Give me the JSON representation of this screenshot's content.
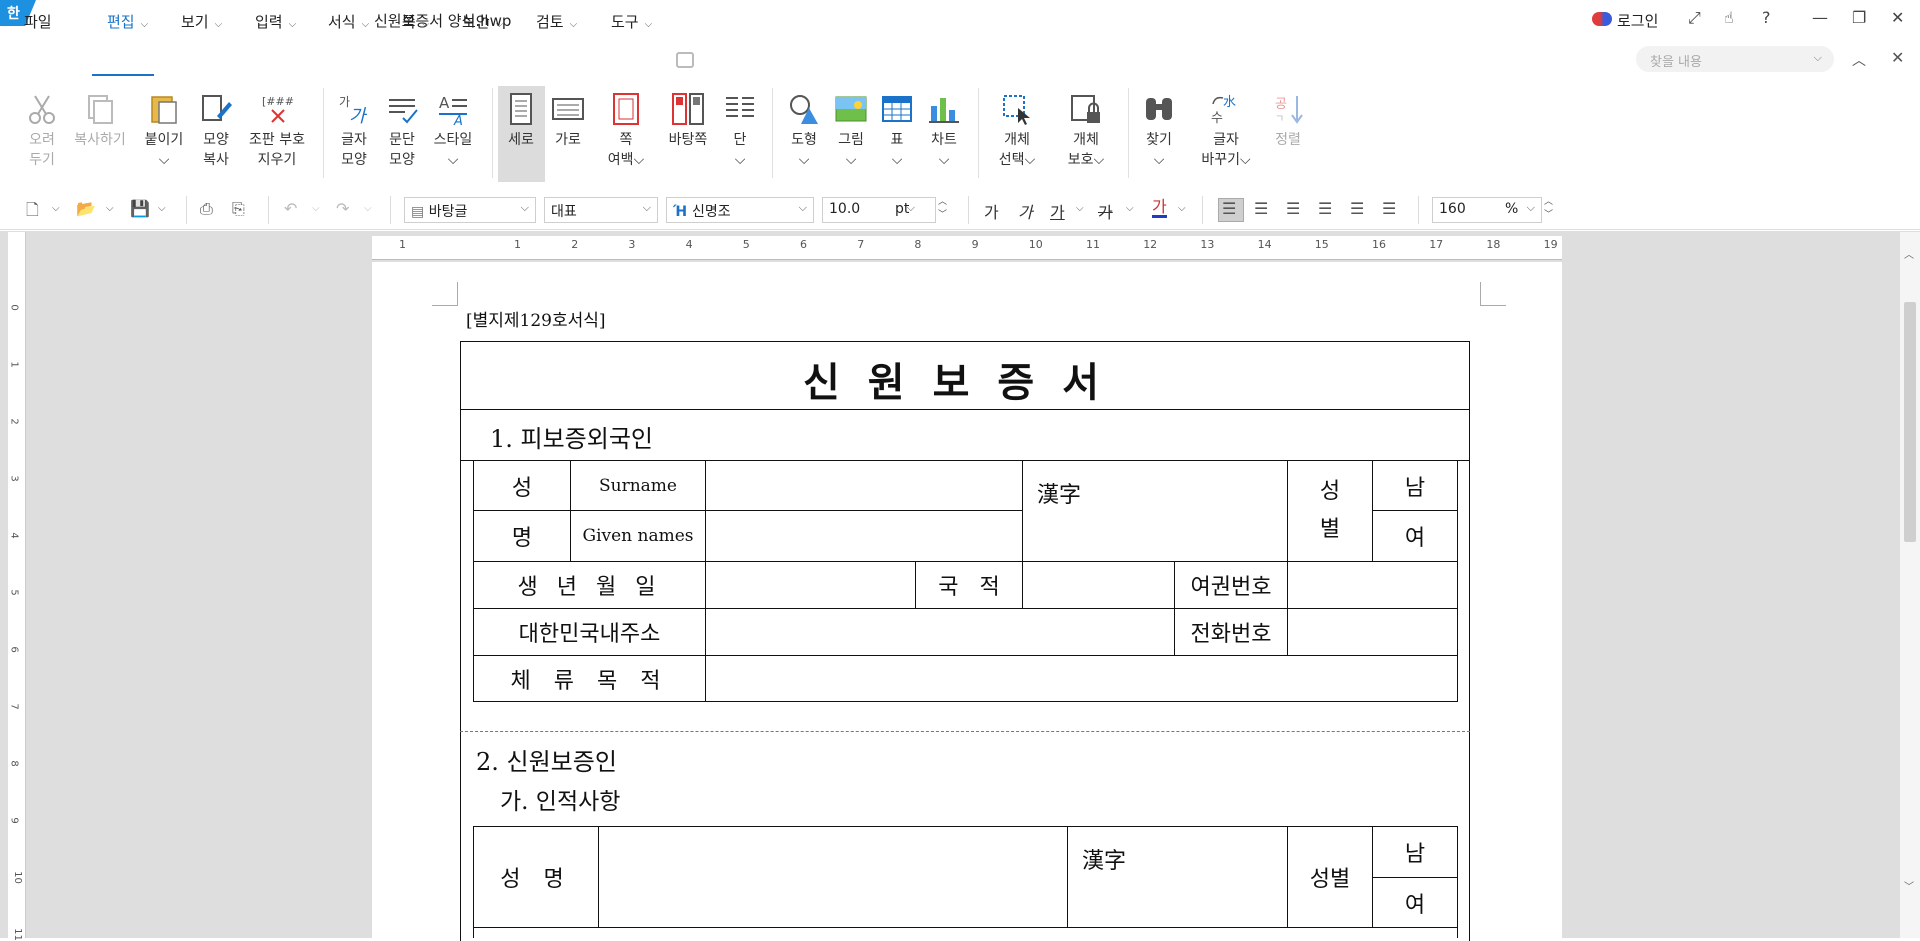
{
  "window": {
    "app_logo": "한",
    "title": "신원보증서 양식.hwp",
    "login_label": "로그인",
    "controls": [
      "⤢",
      "☝",
      "?",
      "—",
      "❐",
      "✕"
    ]
  },
  "menu": {
    "items": [
      "파일",
      "편집",
      "보기",
      "입력",
      "서식",
      "쪽",
      "보안",
      "검토",
      "도구"
    ],
    "search_placeholder": "찾을 내용"
  },
  "ribbon": {
    "cut": [
      "오려",
      "두기"
    ],
    "copy": "복사하기",
    "paste": "붙이기",
    "format_copy": [
      "모양",
      "복사"
    ],
    "erase_codes": [
      "조판 부호",
      "지우기"
    ],
    "char_shape": [
      "글자",
      "모양"
    ],
    "para_shape": [
      "문단",
      "모양"
    ],
    "style": "스타일",
    "portrait": "세로",
    "landscape": "가로",
    "page_margin": [
      "쪽",
      "여백"
    ],
    "master_page": "바탕쪽",
    "columns": "단",
    "shapes": "도형",
    "picture": "그림",
    "table": "표",
    "chart": "차트",
    "obj_select": [
      "개체",
      "선택"
    ],
    "obj_protect": [
      "개체",
      "보호"
    ],
    "find": "찾기",
    "replace": [
      "글자",
      "바꾸기"
    ],
    "sort": "정렬"
  },
  "format": {
    "style_value": "바탕글",
    "font_lang": "대표",
    "font_name": "신명조",
    "font_size": "10.0",
    "font_unit": "pt",
    "zoom": "160",
    "zoom_unit": "%",
    "bold": "가",
    "italic": "가",
    "underline": "가",
    "strike": "가",
    "color_char": "가"
  },
  "ruler": {
    "h_ticks": [
      "1",
      "1",
      "2",
      "3",
      "4",
      "5",
      "6",
      "7",
      "8",
      "9",
      "10",
      "11",
      "12",
      "13",
      "14",
      "15",
      "16",
      "17",
      "18",
      "19"
    ],
    "v_ticks": [
      "0",
      "1",
      "2",
      "3",
      "4",
      "5",
      "6",
      "7",
      "8",
      "9",
      "10",
      "11"
    ]
  },
  "document": {
    "form_label": "[별지제129호서식]",
    "title": "신원보증서",
    "section1": "1.   피보증외국인",
    "s1": {
      "surname_hdr": "성",
      "surname_en": "Surname",
      "given_hdr": "명",
      "given_en": "Given names",
      "hanja": "漢字",
      "gender_hdr": "성\n별",
      "gender_m": "남",
      "gender_f": "여",
      "birth": "생 년 월 일",
      "nationality": "국   적",
      "passport": "여권번호",
      "address": "대한민국내주소",
      "phone": "전화번호",
      "purpose": "체 류 목 적"
    },
    "section2": "2.   신원보증인",
    "section2a": "가. 인적사항",
    "s2": {
      "name_hdr": "성 명",
      "hanja": "漢字",
      "gender_hdr": "성별",
      "gender_m": "남",
      "gender_f": "여"
    }
  }
}
